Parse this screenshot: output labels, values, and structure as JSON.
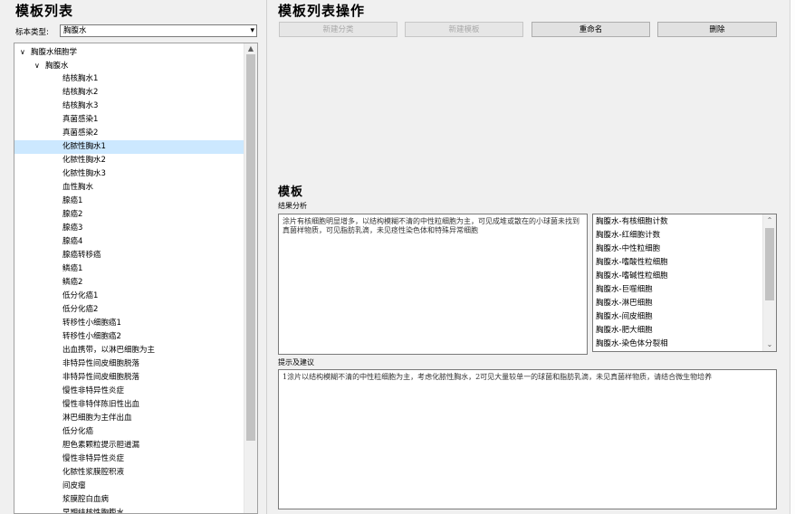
{
  "left": {
    "title": "模板列表",
    "type_label": "标本类型:",
    "type_value": "胸腹水",
    "tree": [
      {
        "label": "胸腹水细胞学",
        "level": 0,
        "toggle": "∨"
      },
      {
        "label": "胸腹水",
        "level": 1,
        "toggle": "∨"
      },
      {
        "label": "结核胸水1",
        "level": 2
      },
      {
        "label": "结核胸水2",
        "level": 2
      },
      {
        "label": "结核胸水3",
        "level": 2
      },
      {
        "label": "真菌感染1",
        "level": 2
      },
      {
        "label": "真菌感染2",
        "level": 2
      },
      {
        "label": "化脓性胸水1",
        "level": 2,
        "selected": true
      },
      {
        "label": "化脓性胸水2",
        "level": 2
      },
      {
        "label": "化脓性胸水3",
        "level": 2
      },
      {
        "label": "血性胸水",
        "level": 2
      },
      {
        "label": "腺癌1",
        "level": 2
      },
      {
        "label": "腺癌2",
        "level": 2
      },
      {
        "label": "腺癌3",
        "level": 2
      },
      {
        "label": "腺癌4",
        "level": 2
      },
      {
        "label": "腺癌转移癌",
        "level": 2
      },
      {
        "label": "鳞癌1",
        "level": 2
      },
      {
        "label": "鳞癌2",
        "level": 2
      },
      {
        "label": "低分化癌1",
        "level": 2
      },
      {
        "label": "低分化癌2",
        "level": 2
      },
      {
        "label": "转移性小细胞癌1",
        "level": 2
      },
      {
        "label": "转移性小细胞癌2",
        "level": 2
      },
      {
        "label": "出血携带，以淋巴细胞为主",
        "level": 2
      },
      {
        "label": "非特异性间皮细胞脱落",
        "level": 2
      },
      {
        "label": "非特异性间皮细胞脱落",
        "level": 2
      },
      {
        "label": "慢性非特异性炎症",
        "level": 2
      },
      {
        "label": "慢性非特伴陈旧性出血",
        "level": 2
      },
      {
        "label": "淋巴细胞为主伴出血",
        "level": 2
      },
      {
        "label": "低分化癌",
        "level": 2
      },
      {
        "label": "胆色素颗粒提示胆道漏",
        "level": 2
      },
      {
        "label": "慢性非特异性炎症",
        "level": 2
      },
      {
        "label": "化脓性浆膜腔积液",
        "level": 2
      },
      {
        "label": "间皮瘤",
        "level": 2
      },
      {
        "label": "浆膜腔白血病",
        "level": 2
      },
      {
        "label": "早期结核性胸腹水",
        "level": 2
      }
    ]
  },
  "right": {
    "title": "模板列表操作",
    "buttons": [
      {
        "label": "新建分类",
        "disabled": true
      },
      {
        "label": "新建模板",
        "disabled": true
      },
      {
        "label": "重命名",
        "disabled": false
      },
      {
        "label": "删除",
        "disabled": false
      }
    ],
    "template_title": "模板",
    "analysis_label": "结果分析",
    "analysis_text": "涂片有核细胞明显增多，以结构模糊不清的中性粒细胞为主，可见成堆或散在的小球菌未找到真菌样物质，可见脂肪乳滴，未见痉性染色体和特殊异常细胞",
    "items": [
      "胸腹水-有核细胞计数",
      "胸腹水-红细胞计数",
      "胸腹水-中性粒细胞",
      "胸腹水-嗜酸性粒细胞",
      "胸腹水-嗜碱性粒细胞",
      "胸腹水-巨噬细胞",
      "胸腹水-淋巴细胞",
      "胸腹水-间皮细胞",
      "胸腹水-肥大细胞",
      "胸腹水-染色体分裂相"
    ],
    "suggest_label": "提示及建议",
    "suggest_text": "1涂片以结构模糊不清的中性粒细胞为主，考虑化脓性胸水，2可见大量较单一的球菌和脂肪乳滴，未见真菌样物质，请结合微生物培养"
  },
  "colors": {
    "selection": "#cce8ff",
    "background": "#f0f0f0"
  }
}
